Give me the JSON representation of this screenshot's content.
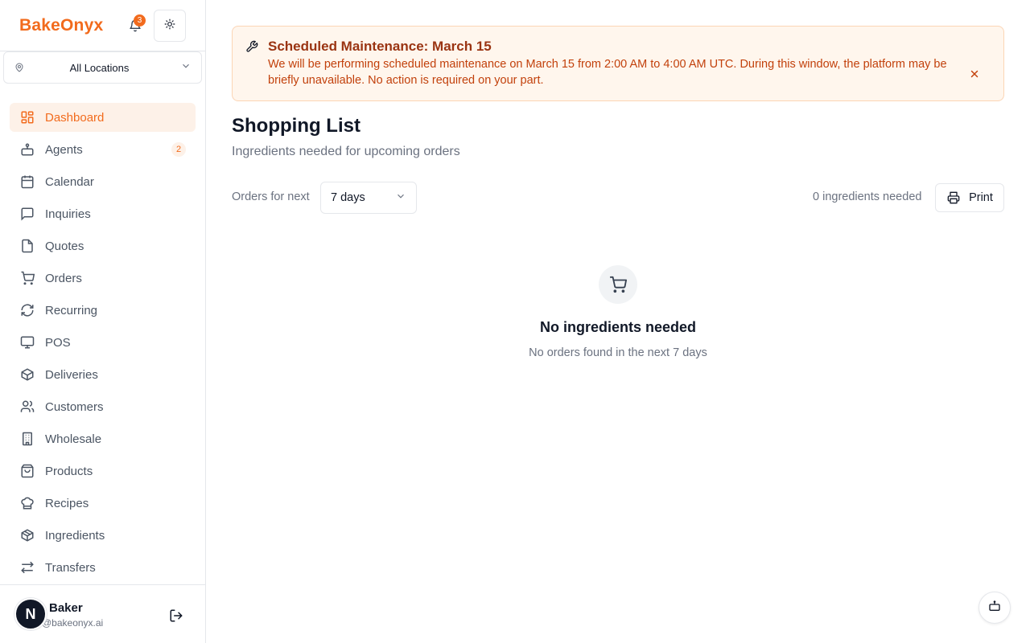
{
  "colors": {
    "brand": "#f26b1d",
    "banner_bg": "#fff6ed",
    "banner_text": "#c2410c",
    "active_bg": "#fdf1e8"
  },
  "header": {
    "brand": "BakeOnyx",
    "notification_count": "3"
  },
  "location": {
    "label": "All Locations"
  },
  "sidebar": {
    "items": [
      {
        "label": "Dashboard",
        "icon": "dashboard-icon",
        "active": true
      },
      {
        "label": "Agents",
        "icon": "bot-icon",
        "badge": "2"
      },
      {
        "label": "Calendar",
        "icon": "calendar-icon"
      },
      {
        "label": "Inquiries",
        "icon": "message-icon"
      },
      {
        "label": "Quotes",
        "icon": "file-icon"
      },
      {
        "label": "Orders",
        "icon": "cart-icon"
      },
      {
        "label": "Recurring",
        "icon": "refresh-icon"
      },
      {
        "label": "POS",
        "icon": "monitor-icon"
      },
      {
        "label": "Deliveries",
        "icon": "package-icon"
      },
      {
        "label": "Customers",
        "icon": "users-icon"
      },
      {
        "label": "Wholesale",
        "icon": "building-icon"
      },
      {
        "label": "Products",
        "icon": "shopping-bag-icon"
      },
      {
        "label": "Recipes",
        "icon": "chef-hat-icon"
      },
      {
        "label": "Ingredients",
        "icon": "box-icon"
      },
      {
        "label": "Transfers",
        "icon": "transfer-icon"
      }
    ]
  },
  "user": {
    "name": "Baker",
    "email": "@bakeonyx.ai",
    "avatar_letter": "N"
  },
  "banner": {
    "title": "Scheduled Maintenance: March 15",
    "text": "We will be performing scheduled maintenance on March 15 from 2:00 AM to 4:00 AM UTC. During this window, the platform may be briefly unavailable. No action is required on your part."
  },
  "page": {
    "title": "Shopping List",
    "subtitle": "Ingredients needed for upcoming orders"
  },
  "toolbar": {
    "orders_label": "Orders for next",
    "period_value": "7 days",
    "count_text": "0 ingredients needed",
    "print_label": "Print"
  },
  "empty_state": {
    "title": "No ingredients needed",
    "subtitle": "No orders found in the next 7 days"
  }
}
